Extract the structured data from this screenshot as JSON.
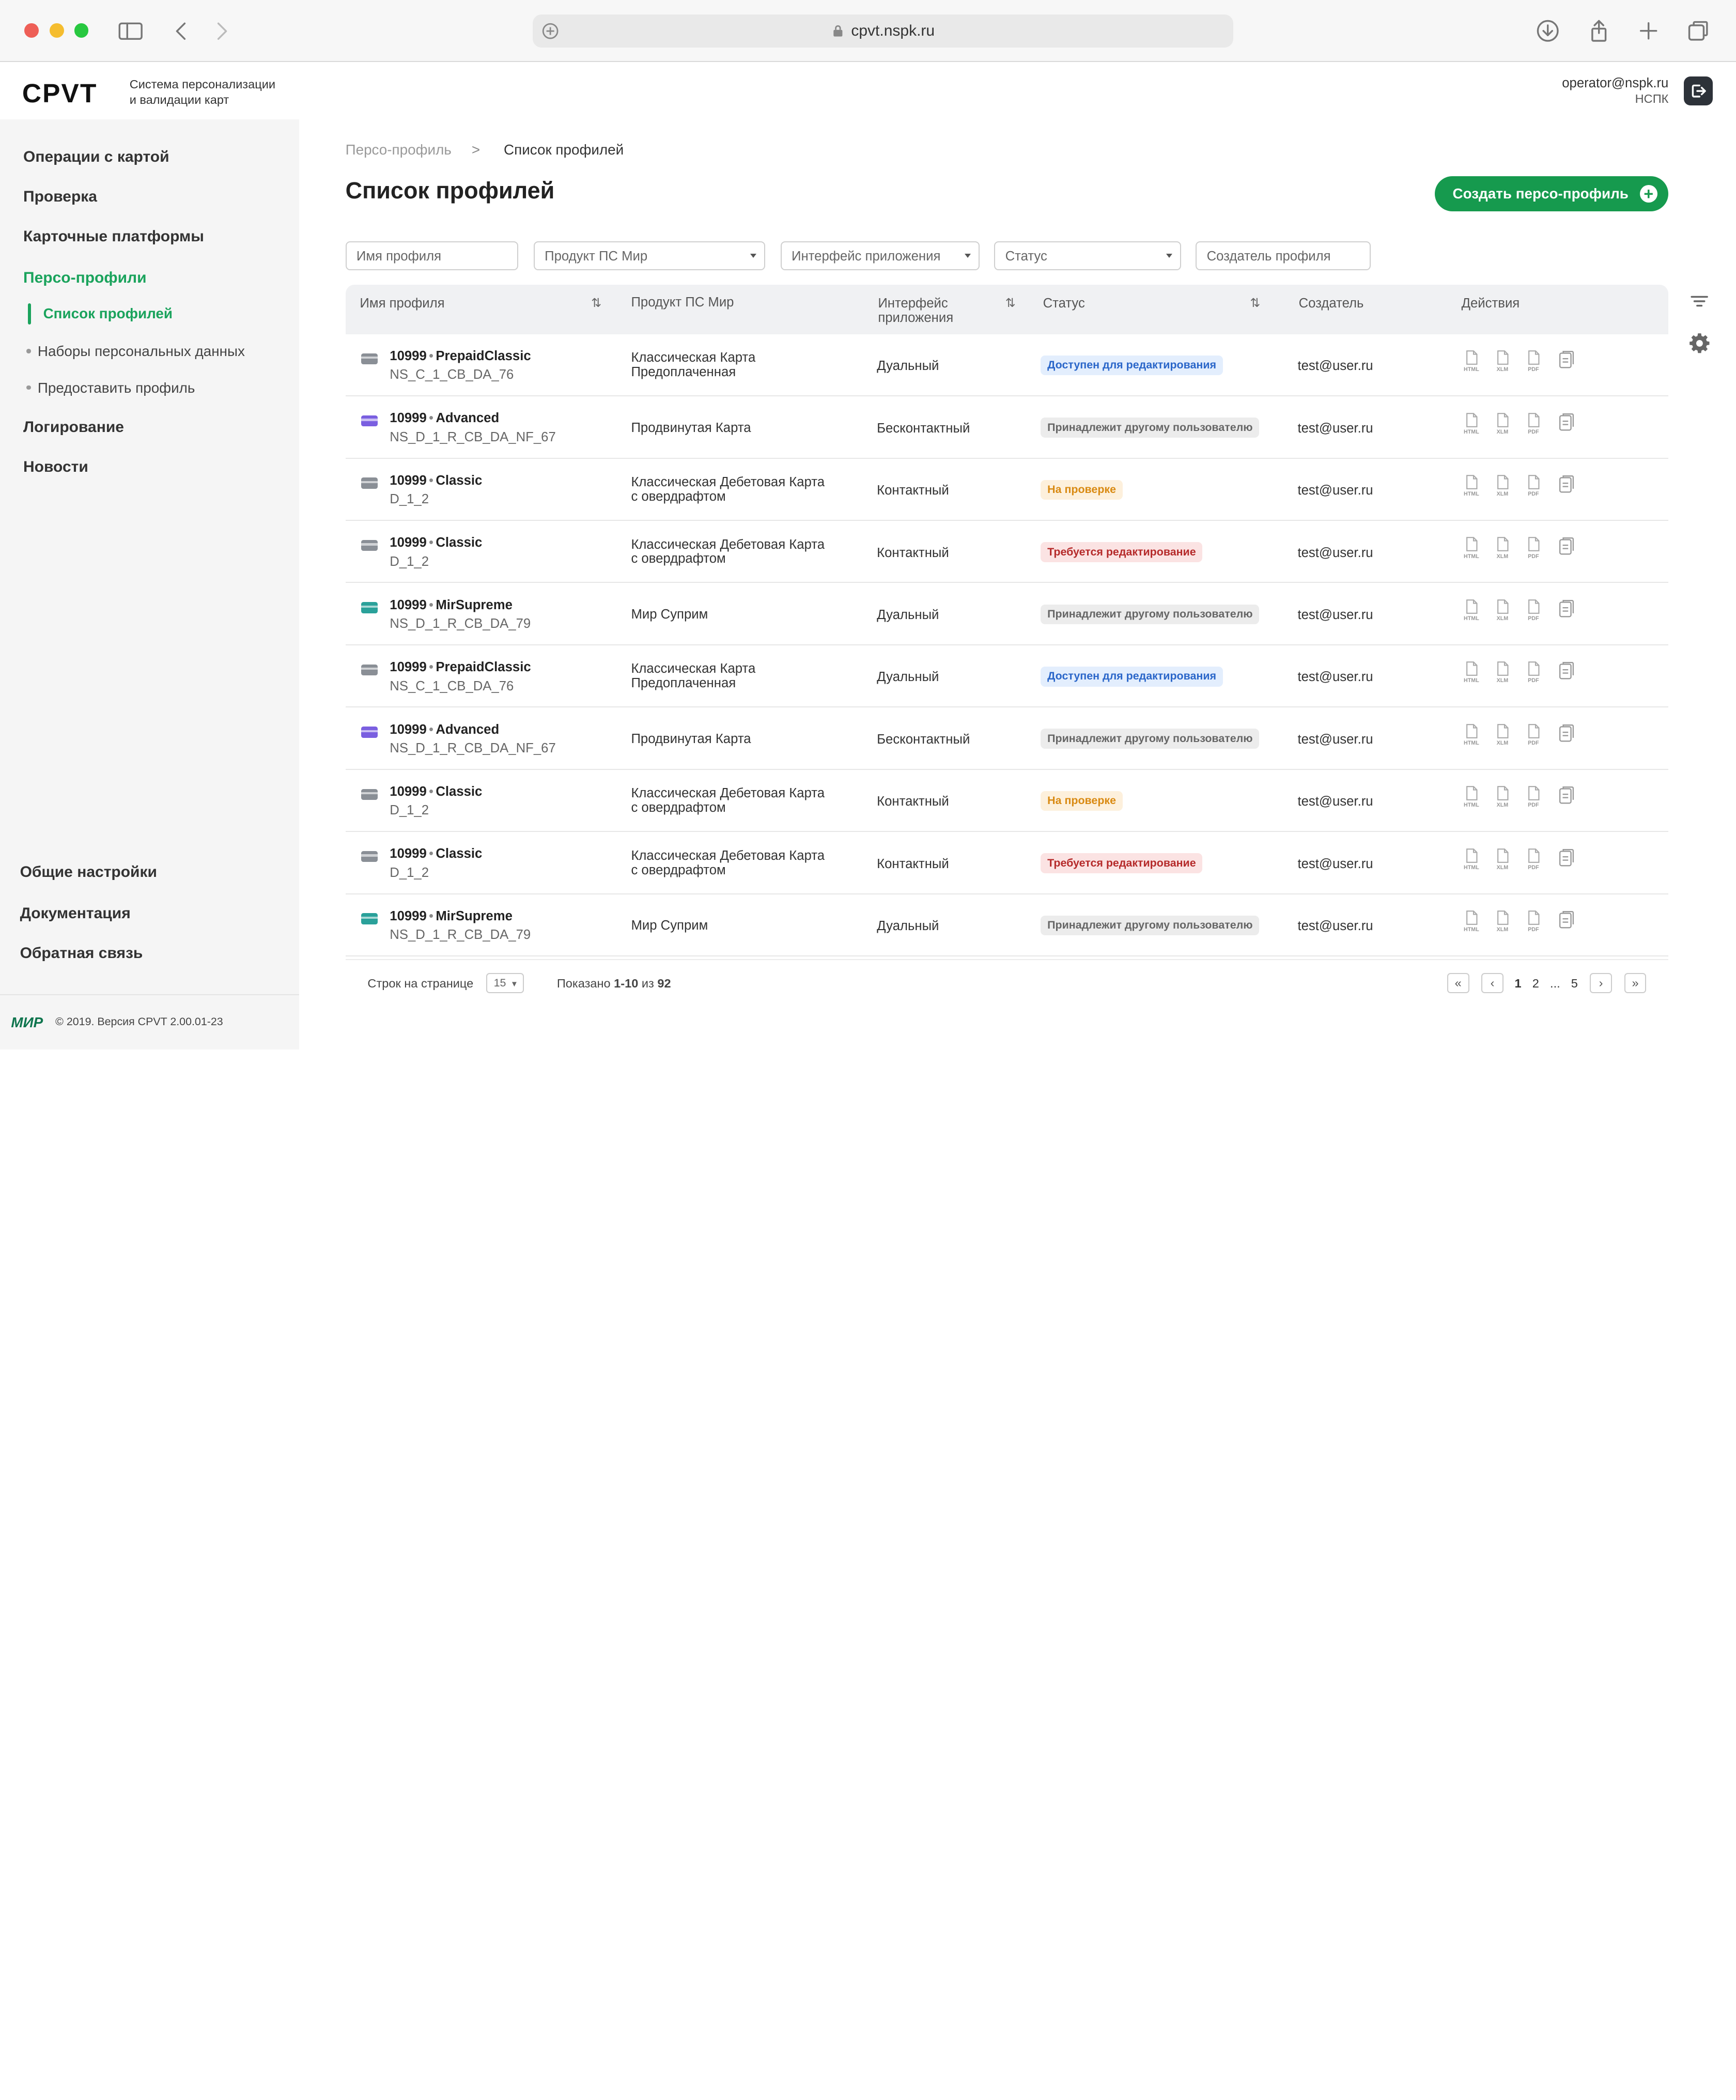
{
  "browser": {
    "url": "cpvt.nspk.ru"
  },
  "app": {
    "logo": "CPVT",
    "tagline_1": "Система персонализации",
    "tagline_2": "и валидации карт",
    "user_email": "operator@nspk.ru",
    "user_org": "НСПК"
  },
  "sidebar": {
    "items": [
      "Операции с картой",
      "Проверка",
      "Карточные платформы",
      "Персо-профили"
    ],
    "sub": [
      "Список профилей",
      "Наборы персональных данных",
      "Предоставить профиль"
    ],
    "items_after": [
      "Логирование",
      "Новости"
    ],
    "bottom": [
      "Общие настройки",
      "Документация",
      "Обратная связь"
    ],
    "footer_logo": "МИР",
    "footer_text": "© 2019. Версия CPVT 2.00.01-23"
  },
  "breadcrumb": {
    "parent": "Персо-профиль",
    "sep": ">",
    "current": "Список профилей"
  },
  "page": {
    "title": "Список профилей",
    "create_button": "Создать персо-профиль"
  },
  "filters": {
    "name": "Имя профиля",
    "product": "Продукт ПС Мир",
    "interface": "Интерфейс приложения",
    "status": "Статус",
    "creator": "Создатель профиля"
  },
  "table": {
    "headers": {
      "name": "Имя профиля",
      "product": "Продукт ПС Мир",
      "interface_1": "Интерфейс",
      "interface_2": "приложения",
      "status": "Статус",
      "creator": "Создатель",
      "actions": "Действия"
    },
    "sort_icon": "⇅",
    "action_labels": [
      "HTML",
      "XLM",
      "PDF"
    ],
    "rows": [
      {
        "num": "10999",
        "name": "PrepaidClassic",
        "code": "NS_C_1_CB_DA_76",
        "product_1": "Классическая Карта",
        "product_2": "Предоплаченная",
        "interface": "Дуальный",
        "status": "Доступен для редактирования",
        "status_kind": "blue",
        "creator": "test@user.ru",
        "card_color": "#8a8f96"
      },
      {
        "num": "10999",
        "name": "Advanced",
        "code": "NS_D_1_R_CB_DA_NF_67",
        "product_1": "Продвинутая Карта",
        "product_2": "",
        "interface": "Бесконтактный",
        "status": "Принадлежит другому пользователю",
        "status_kind": "gray",
        "creator": "test@user.ru",
        "card_color": "#7a5fe0"
      },
      {
        "num": "10999",
        "name": "Classic",
        "code": "D_1_2",
        "product_1": "Классическая Дебетовая Карта",
        "product_2": "с овердрафтом",
        "interface": "Контактный",
        "status": "На проверке",
        "status_kind": "orange",
        "creator": "test@user.ru",
        "card_color": "#8a8f96"
      },
      {
        "num": "10999",
        "name": "Classic",
        "code": "D_1_2",
        "product_1": "Классическая Дебетовая Карта",
        "product_2": "с овердрафтом",
        "interface": "Контактный",
        "status": "Требуется редактирование",
        "status_kind": "red",
        "creator": "test@user.ru",
        "card_color": "#8a8f96"
      },
      {
        "num": "10999",
        "name": "MirSupreme",
        "code": "NS_D_1_R_CB_DA_79",
        "product_1": "Мир Суприм",
        "product_2": "",
        "interface": "Дуальный",
        "status": "Принадлежит другому пользователю",
        "status_kind": "gray",
        "creator": "test@user.ru",
        "card_color": "#2aa19a"
      },
      {
        "num": "10999",
        "name": "PrepaidClassic",
        "code": "NS_C_1_CB_DA_76",
        "product_1": "Классическая Карта",
        "product_2": "Предоплаченная",
        "interface": "Дуальный",
        "status": "Доступен для редактирования",
        "status_kind": "blue",
        "creator": "test@user.ru",
        "card_color": "#8a8f96"
      },
      {
        "num": "10999",
        "name": "Advanced",
        "code": "NS_D_1_R_CB_DA_NF_67",
        "product_1": "Продвинутая Карта",
        "product_2": "",
        "interface": "Бесконтактный",
        "status": "Принадлежит другому пользователю",
        "status_kind": "gray",
        "creator": "test@user.ru",
        "card_color": "#7a5fe0"
      },
      {
        "num": "10999",
        "name": "Classic",
        "code": "D_1_2",
        "product_1": "Классическая Дебетовая Карта",
        "product_2": "с овердрафтом",
        "interface": "Контактный",
        "status": "На проверке",
        "status_kind": "orange",
        "creator": "test@user.ru",
        "card_color": "#8a8f96"
      },
      {
        "num": "10999",
        "name": "Classic",
        "code": "D_1_2",
        "product_1": "Классическая Дебетовая Карта",
        "product_2": "с овердрафтом",
        "interface": "Контактный",
        "status": "Требуется редактирование",
        "status_kind": "red",
        "creator": "test@user.ru",
        "card_color": "#8a8f96"
      },
      {
        "num": "10999",
        "name": "MirSupreme",
        "code": "NS_D_1_R_CB_DA_79",
        "product_1": "Мир Суприм",
        "product_2": "",
        "interface": "Дуальный",
        "status": "Принадлежит другому пользователю",
        "status_kind": "gray",
        "creator": "test@user.ru",
        "card_color": "#2aa19a"
      }
    ]
  },
  "pagination": {
    "rows_label": "Строк на странице",
    "rows_value": "15",
    "shown_prefix": "Показано",
    "shown_range": "1-10",
    "shown_of": "из",
    "total": "92",
    "pages": [
      "1",
      "2",
      "...",
      "5"
    ]
  },
  "colors": {
    "accent": "#169a4e",
    "active_nav": "#1aa35c"
  }
}
